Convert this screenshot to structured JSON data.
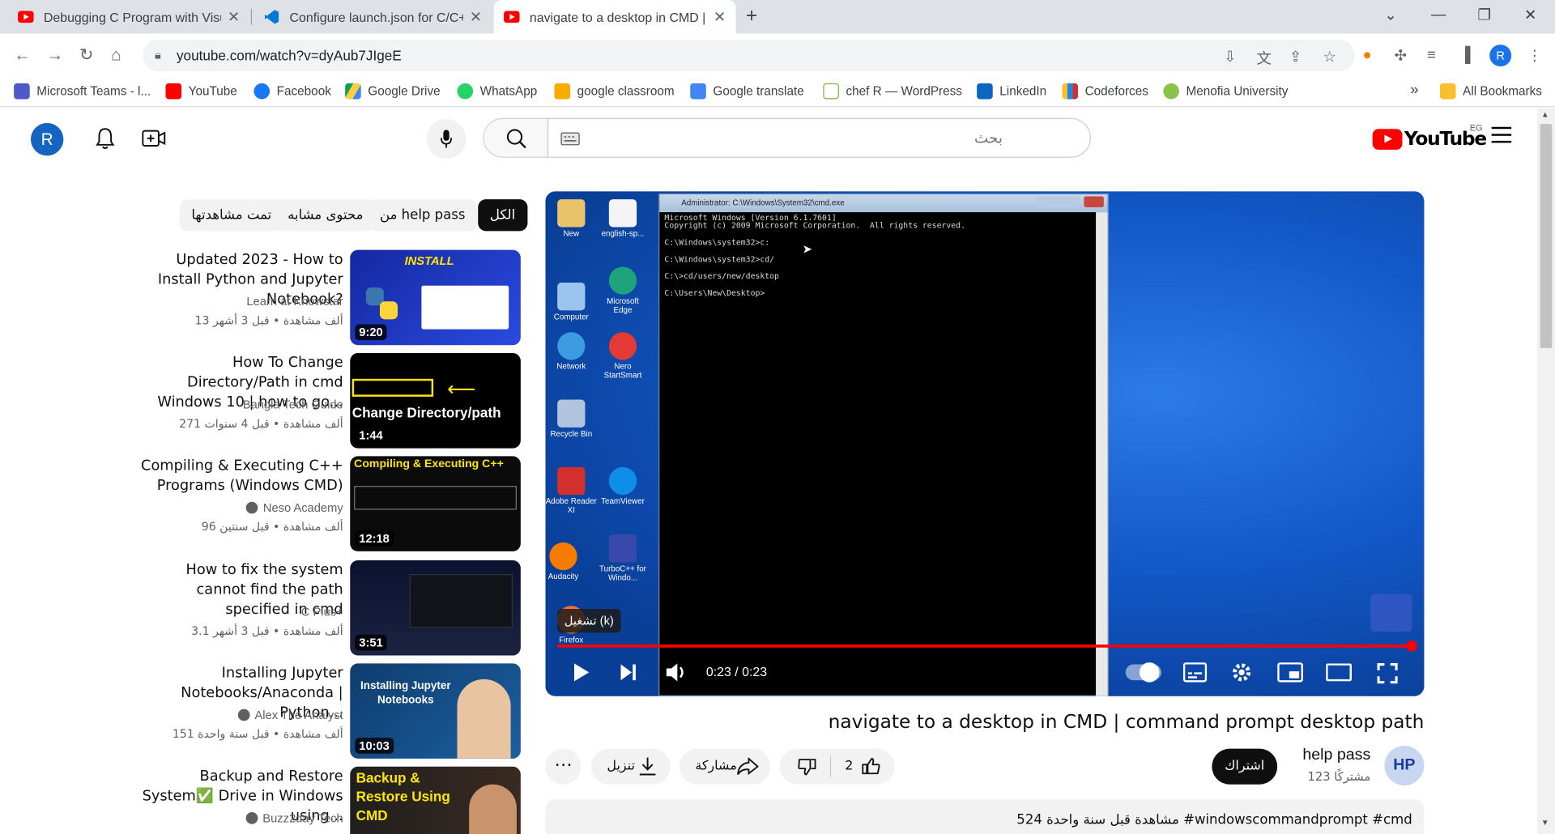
{
  "browser": {
    "tabs": [
      {
        "title": "Debugging C Program with Visu",
        "favicon": "youtube-icon"
      },
      {
        "title": "Configure launch.json for C/C+",
        "favicon": "vscode-icon"
      },
      {
        "title": "navigate to a desktop in CMD | c",
        "favicon": "youtube-icon",
        "active": true
      }
    ],
    "url": "youtube.com/watch?v=dyAub7JIgeE",
    "profile_initial": "R",
    "bookmarks": [
      "Microsoft Teams - l...",
      "YouTube",
      "Facebook",
      "Google Drive",
      "WhatsApp",
      "google classroom",
      "Google translate",
      "chef R — WordPress",
      "LinkedIn",
      "Codeforces",
      "Menofia University"
    ],
    "all_bookmarks": "All Bookmarks"
  },
  "youtube": {
    "avatar_initial": "R",
    "search_placeholder": "بحث",
    "logo_text": "YouTube",
    "country_code": "EG",
    "brand_red": "#ff0000"
  },
  "chips": [
    "الكل",
    "من help pass",
    "محتوى مشابه",
    "تمت مشاهدتها"
  ],
  "suggestions": [
    {
      "title": "Updated 2023 - How to Install Python and Jupyter Notebook?",
      "channel": "Learn at Knowstar",
      "verified": false,
      "meta": "13 ألف مشاهدة • قبل 3 أشهر",
      "duration": "9:20",
      "thumb_text": "INSTALL"
    },
    {
      "title": "How To Change Directory/Path in cmd Windows 10 | how to go...",
      "channel": "Bangla Tech Guide",
      "verified": false,
      "meta": "271 ألف مشاهدة • قبل 4 سنوات",
      "duration": "1:44",
      "thumb_text": "Change Directory/path"
    },
    {
      "title": "Compiling & Executing C++ Programs (Windows CMD)",
      "channel": "Neso Academy",
      "verified": true,
      "meta": "96 ألف مشاهدة • قبل سنتين",
      "duration": "12:18",
      "thumb_text": "Compiling & Executing C++"
    },
    {
      "title": "How to fix the system cannot find the path specified in cmd",
      "channel": "C Plus+",
      "verified": false,
      "meta": "3.1 ألف مشاهدة • قبل 3 أشهر",
      "duration": "3:51",
      "thumb_text": ""
    },
    {
      "title": "Installing Jupyter Notebooks/Anaconda | Python...",
      "channel": "Alex The Analyst",
      "verified": true,
      "meta": "151 ألف مشاهدة • قبل سنة واحدة",
      "duration": "10:03",
      "thumb_text": "Installing Jupyter Notebooks"
    },
    {
      "title": "Backup and Restore System✅ Drive in Windows using...",
      "channel": "Buzz2day Tech",
      "verified": true,
      "meta": "",
      "duration": "",
      "thumb_text": "Backup & Restore Using CMD"
    }
  ],
  "player": {
    "cmd_title": "Administrator: C:\\Windows\\System32\\cmd.exe",
    "cmd_lines": "Microsoft Windows [Version 6.1.7601]\nCopyright (c) 2009 Microsoft Corporation.  All rights reserved.\n\nC:\\Windows\\system32>c:\n\nC:\\Windows\\system32>cd/\n\nC:\\>cd/users/new/desktop\n\nC:\\Users\\New\\Desktop>",
    "desktop_icons": [
      "New",
      "english-sp...",
      "Computer",
      "Microsoft Edge",
      "Network",
      "Nero StartSmart",
      "Recycle Bin",
      "Adobe Reader XI",
      "TeamViewer",
      "Audacity",
      "TurboC++ for Windo...",
      "Firefox"
    ],
    "tooltip": "تشغيل (k)",
    "time": "0:23 / 0:23",
    "progress": 1.0
  },
  "video": {
    "title": "navigate to a desktop in CMD | command prompt desktop path",
    "channel": "help pass",
    "channel_logo": "HP",
    "subscribers": "123 مشتركًا",
    "subscribe_label": "اشتراك",
    "likes": "2",
    "share_label": "مشاركة",
    "download_label": "تنزيل",
    "description": "524 مشاهدة  قبل سنة واحدة  #windowscommandprompt #cmd"
  }
}
